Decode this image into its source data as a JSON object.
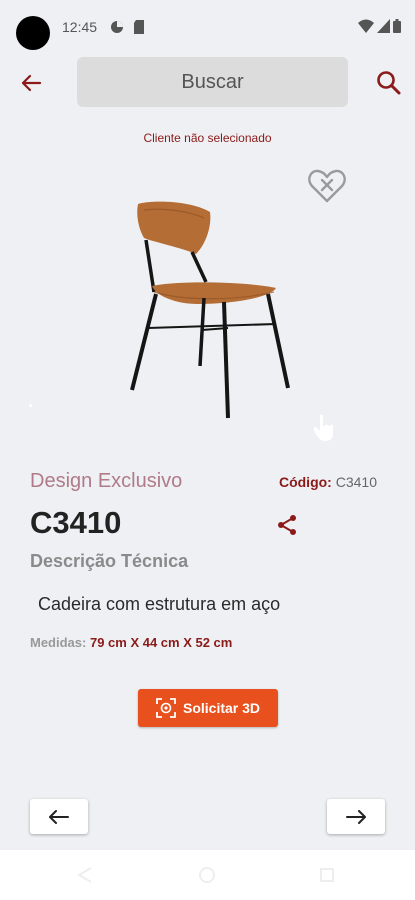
{
  "status_bar": {
    "time": "12:45",
    "icons": [
      "data-saver-icon",
      "sd-card-icon",
      "wifi-icon",
      "signal-icon",
      "battery-icon"
    ]
  },
  "app_bar": {
    "back_icon": "arrow-left-icon",
    "search_label": "Buscar",
    "search_icon": "search-icon"
  },
  "client_status": "Cliente não selecionado",
  "product": {
    "image_icon": "chair-image",
    "favorite_icon": "heart-x-icon",
    "design_label": "Design Exclusivo",
    "code_label": "Código:",
    "code_value": "C3410",
    "title": "C3410",
    "share_icon": "share-icon",
    "tech_heading": "Descrição Técnica",
    "description": "Cadeira com estrutura em aço",
    "measures_label": "Medidas:",
    "measures_value": "79 cm X 44 cm X 52 cm"
  },
  "actions": {
    "request_3d_label": "Solicitar 3D",
    "request_3d_icon": "3d-scan-icon"
  },
  "navigation": {
    "prev_icon": "arrow-left-icon",
    "next_icon": "arrow-right-icon"
  },
  "colors": {
    "accent": "#8b1a1a",
    "button": "#e8511d",
    "background": "#eef0f3"
  }
}
